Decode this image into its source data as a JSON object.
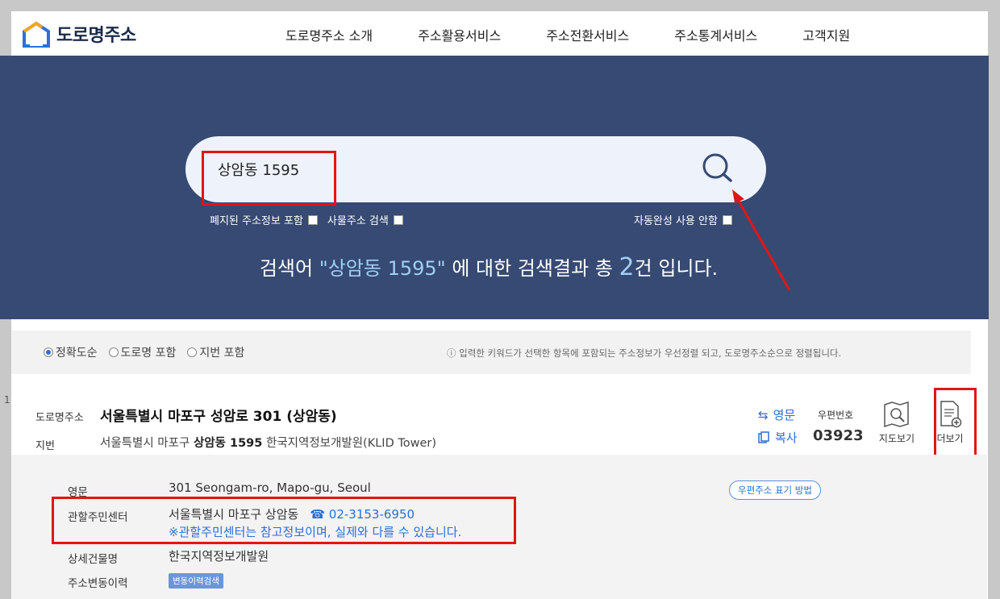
{
  "header": {
    "logo_text": "도로명주소",
    "nav": [
      "도로명주소 소개",
      "주소활용서비스",
      "주소전환서비스",
      "주소통계서비스",
      "고객지원"
    ]
  },
  "search": {
    "query": "상암동 1595",
    "options": {
      "include_abolished": "폐지된 주소정보 포함",
      "business_search": "사물주소 검색",
      "disable_autocomplete": "자동완성 사용 안함"
    },
    "result_prefix": "검색어 ",
    "result_keyword": "\"상암동 1595\"",
    "result_middle": " 에 대한 검색결과 총 ",
    "result_count": "2",
    "result_suffix": "건 입니다."
  },
  "sort": {
    "options": [
      "정확도순",
      "도로명 포함",
      "지번 포함"
    ],
    "selected": "정확도순",
    "note": "ⓘ 입력한 키워드가 선택한 항목에 포함되는 주소정보가 우선정렬 되고, 도로명주소순으로 정렬됩니다."
  },
  "result": {
    "index": "1",
    "road_label": "도로명주소",
    "road_address": "서울특별시 마포구 성암로 301 (상암동)",
    "jibun_label": "지번",
    "jibun_prefix": "서울특별시 마포구 ",
    "jibun_bold": "상암동 1595",
    "jibun_suffix": " 한국지역정보개발원(KLID Tower)",
    "english_btn": "영문",
    "copy_btn": "복사",
    "postal_label": "우편번호",
    "postal_code": "03923",
    "map_btn": "지도보기",
    "more_btn": "더보기"
  },
  "detail": {
    "english_label": "영문",
    "english_value": "301 Seongam-ro, Mapo-gu, Seoul",
    "postal_guide": "우편주소 표기 방법",
    "center_label": "관할주민센터",
    "center_value": "서울특별시 마포구 상암동",
    "center_phone": "☎ 02-3153-6950",
    "center_note": "※관할주민센터는 참고정보이며, 실제와 다를 수 있습니다.",
    "building_label": "상세건물명",
    "building_value": "한국지역정보개발원",
    "history_label": "주소변동이력",
    "history_btn": "변동이력검색"
  },
  "colors": {
    "hero_bg": "#364a73",
    "accent_blue": "#2a6fd6",
    "highlight_red": "#e01616"
  }
}
